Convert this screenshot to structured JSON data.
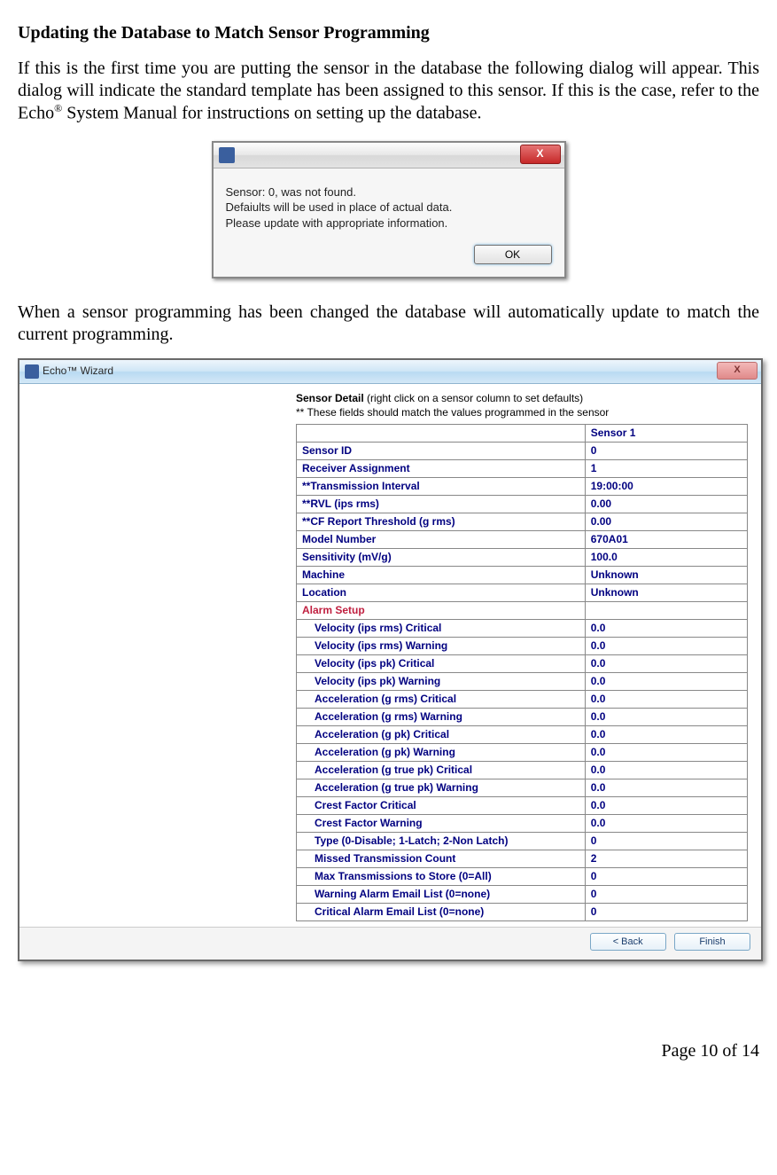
{
  "heading": "Updating the Database to Match Sensor Programming",
  "para1_a": "If this is the first time you are putting the sensor in the database the following dialog will appear.  This dialog will indicate the standard template has been assigned to this sensor.  If this is the case, refer to the Echo",
  "para1_sup": "®",
  "para1_b": " System Manual for instructions on setting up the database.",
  "dlg1": {
    "close_label": "X",
    "line1": "Sensor: 0, was not found.",
    "line2": "Defaiults will be used in place of actual data.",
    "line3": "Please update with appropriate information.",
    "ok_label": "OK"
  },
  "para2": "When a sensor programming has been changed the database will automatically update to match the current programming.",
  "dlg2": {
    "title": "Echo™  Wizard",
    "close_label": "X",
    "header_title": "Sensor Detail",
    "header_sub": " (right click on a sensor column to set defaults)",
    "header_note": "** These fields should match the values programmed in the sensor",
    "col_header": "Sensor 1",
    "rows": [
      {
        "label": "Sensor ID",
        "value": "0",
        "indent": false
      },
      {
        "label": "Receiver Assignment",
        "value": "1",
        "indent": false
      },
      {
        "label": "**Transmission Interval",
        "value": "19:00:00",
        "indent": false
      },
      {
        "label": "**RVL (ips rms)",
        "value": "0.00",
        "indent": false
      },
      {
        "label": "**CF Report Threshold (g rms)",
        "value": "0.00",
        "indent": false
      },
      {
        "label": "Model Number",
        "value": "670A01",
        "indent": false
      },
      {
        "label": "Sensitivity (mV/g)",
        "value": "100.0",
        "indent": false
      },
      {
        "label": "Machine",
        "value": "Unknown",
        "indent": false
      },
      {
        "label": "Location",
        "value": "Unknown",
        "indent": false
      }
    ],
    "alarm_label": "Alarm Setup",
    "alarm_rows": [
      {
        "label": "Velocity (ips rms) Critical",
        "value": "0.0",
        "indent": true
      },
      {
        "label": "Velocity (ips rms) Warning",
        "value": "0.0",
        "indent": true
      },
      {
        "label": "Velocity (ips pk) Critical",
        "value": "0.0",
        "indent": true
      },
      {
        "label": "Velocity (ips pk) Warning",
        "value": "0.0",
        "indent": true
      },
      {
        "label": "Acceleration (g rms) Critical",
        "value": "0.0",
        "indent": true
      },
      {
        "label": "Acceleration (g rms) Warning",
        "value": "0.0",
        "indent": true
      },
      {
        "label": "Acceleration (g pk) Critical",
        "value": "0.0",
        "indent": true
      },
      {
        "label": "Acceleration (g pk) Warning",
        "value": "0.0",
        "indent": true
      },
      {
        "label": "Acceleration (g true pk) Critical",
        "value": "0.0",
        "indent": true
      },
      {
        "label": "Acceleration (g true pk) Warning",
        "value": "0.0",
        "indent": true
      },
      {
        "label": "Crest Factor Critical",
        "value": "0.0",
        "indent": true
      },
      {
        "label": "Crest Factor Warning",
        "value": "0.0",
        "indent": true
      },
      {
        "label": "Type (0-Disable; 1-Latch; 2-Non Latch)",
        "value": "0",
        "indent": true
      },
      {
        "label": "Missed Transmission Count",
        "value": "2",
        "indent": true
      },
      {
        "label": "Max Transmissions to Store (0=All)",
        "value": "0",
        "indent": true
      },
      {
        "label": "Warning Alarm Email List (0=none)",
        "value": "0",
        "indent": true
      },
      {
        "label": "Critical Alarm Email List (0=none)",
        "value": "0",
        "indent": true
      }
    ],
    "back_label": "<  Back",
    "finish_label": "Finish"
  },
  "page_number": "Page 10 of 14"
}
